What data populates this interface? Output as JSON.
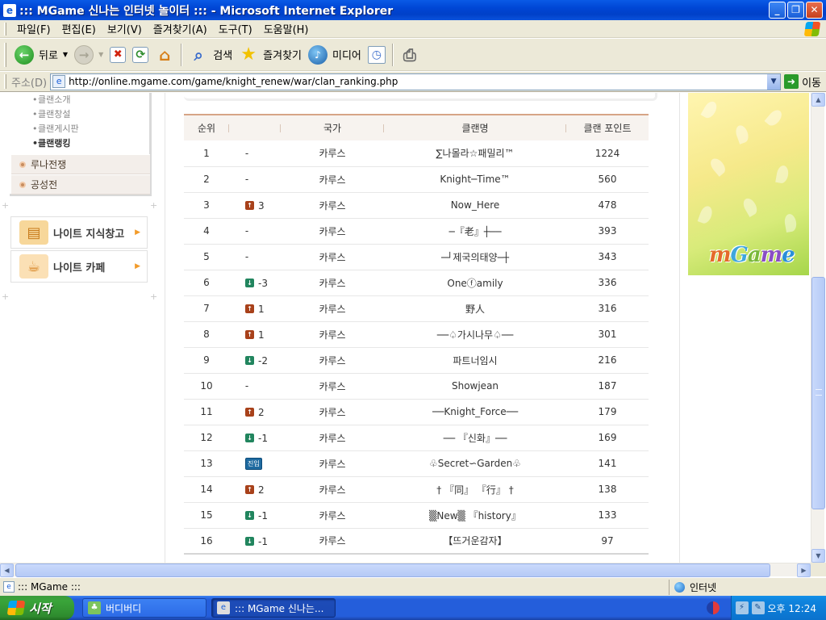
{
  "window": {
    "title": "::: MGame 신나는 인터넷 놀이터 ::: - Microsoft Internet Explorer",
    "minimize_glyph": "_",
    "maximize_glyph": "❐",
    "close_glyph": "✕"
  },
  "menubar": {
    "items": [
      "파일(F)",
      "편집(E)",
      "보기(V)",
      "즐겨찾기(A)",
      "도구(T)",
      "도움말(H)"
    ]
  },
  "toolbar": {
    "back_label": "뒤로",
    "search_label": "검색",
    "favorites_label": "즐겨찾기",
    "media_label": "미디어"
  },
  "addressbar": {
    "label": "주소(D)",
    "url": "http://online.mgame.com/game/knight_renew/war/clan_ranking.php",
    "go_label": "이동"
  },
  "sidebar": {
    "sub_items": [
      {
        "label": "클랜소개",
        "active": false
      },
      {
        "label": "클랜창설",
        "active": false
      },
      {
        "label": "클랜게시판",
        "active": false
      },
      {
        "label": "클랜랭킹",
        "active": true
      }
    ],
    "menu_items": [
      "루나전쟁",
      "공성전"
    ],
    "quick_links": [
      {
        "label": "나이트 지식창고",
        "icon": "books-icon"
      },
      {
        "label": "나이트 카페",
        "icon": "cafe-icon"
      }
    ]
  },
  "ranking": {
    "headers": [
      "순위",
      "",
      "국가",
      "클랜명",
      "클랜 포인트"
    ],
    "rows": [
      {
        "rank": "1",
        "change_type": "none",
        "change": "-",
        "nation": "카루스",
        "clan": "∑나몰라☆패밀리™",
        "points": "1224"
      },
      {
        "rank": "2",
        "change_type": "none",
        "change": "-",
        "nation": "카루스",
        "clan": "Knight─Time™",
        "points": "560"
      },
      {
        "rank": "3",
        "change_type": "up",
        "change": "3",
        "nation": "카루스",
        "clan": "Now_Here",
        "points": "478"
      },
      {
        "rank": "4",
        "change_type": "none",
        "change": "-",
        "nation": "카루스",
        "clan": "─『老』┼──",
        "points": "393"
      },
      {
        "rank": "5",
        "change_type": "none",
        "change": "-",
        "nation": "카루스",
        "clan": "─┘제국의태양─┼",
        "points": "343"
      },
      {
        "rank": "6",
        "change_type": "down",
        "change": "-3",
        "nation": "카루스",
        "clan": "Oneⓕamily",
        "points": "336"
      },
      {
        "rank": "7",
        "change_type": "up",
        "change": "1",
        "nation": "카루스",
        "clan": "野人",
        "points": "316"
      },
      {
        "rank": "8",
        "change_type": "up",
        "change": "1",
        "nation": "카루스",
        "clan": "──♤가시나무♤──",
        "points": "301"
      },
      {
        "rank": "9",
        "change_type": "down",
        "change": "-2",
        "nation": "카루스",
        "clan": "파트너임시",
        "points": "216"
      },
      {
        "rank": "10",
        "change_type": "none",
        "change": "-",
        "nation": "카루스",
        "clan": "Showjean",
        "points": "187"
      },
      {
        "rank": "11",
        "change_type": "up",
        "change": "2",
        "nation": "카루스",
        "clan": "──Knight_Force──",
        "points": "179"
      },
      {
        "rank": "12",
        "change_type": "down",
        "change": "-1",
        "nation": "카루스",
        "clan": "── 『신화』──",
        "points": "169"
      },
      {
        "rank": "13",
        "change_type": "new",
        "change": "진입",
        "nation": "카루스",
        "clan": "♧Secret∽Garden♧",
        "points": "141"
      },
      {
        "rank": "14",
        "change_type": "up",
        "change": "2",
        "nation": "카루스",
        "clan": "† 『同』 『行』 †",
        "points": "138"
      },
      {
        "rank": "15",
        "change_type": "down",
        "change": "-1",
        "nation": "카루스",
        "clan": "▒New▒ 『history』",
        "points": "133"
      },
      {
        "rank": "16",
        "change_type": "down",
        "change": "-1",
        "nation": "카루스",
        "clan": "【뜨거운감자】",
        "points": "97"
      }
    ]
  },
  "banner": {
    "logo_letters": [
      "m",
      "G",
      "a",
      "m",
      "e"
    ],
    "colors": [
      "#e46b2b",
      "#3ea6dc",
      "#79b83a",
      "#8a4ec4",
      "#2a8fd8"
    ]
  },
  "statusbar": {
    "text": "::: MGame :::",
    "zone": "인터넷"
  },
  "taskbar": {
    "start_label": "시작",
    "tasks": [
      {
        "label": "버디버디",
        "active": false
      },
      {
        "label": "::: MGame 신나는...",
        "active": true
      }
    ],
    "clock": "오후 12:24"
  },
  "colors": {
    "title_bar": "#0046d5",
    "header_border": "#d6a486",
    "header_bg": "#f7f3ef",
    "nation_text": "#8a5a3a",
    "up_arrow": "#a8411a",
    "down_arrow": "#21855e",
    "new_badge": "#1e6aa0"
  }
}
